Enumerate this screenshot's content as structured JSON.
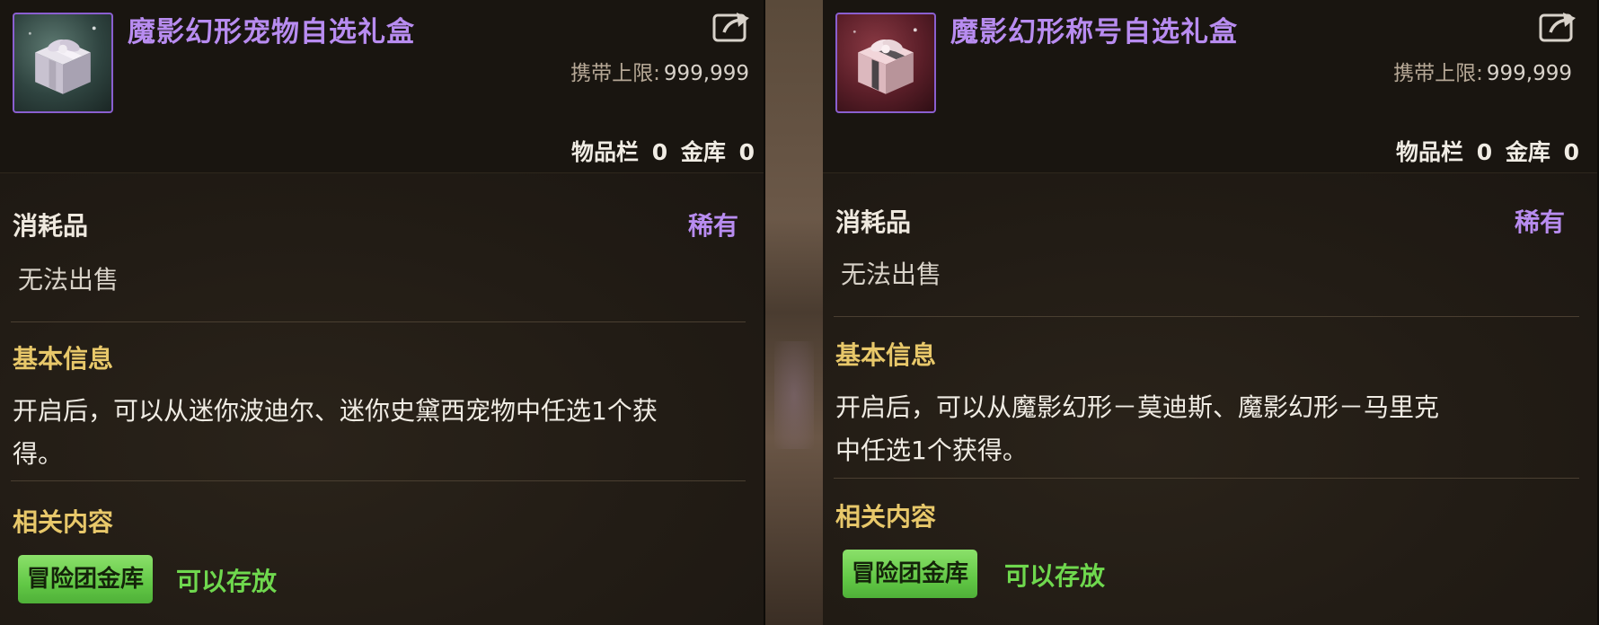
{
  "panels": [
    {
      "title": "魔影幻形宠物自选礼盒",
      "icon": "gift-box-icon",
      "icon_bg": "#2f4440",
      "carry_limit_label": "携带上限:",
      "carry_limit_value": "999,999",
      "inventory_label": "物品栏",
      "inventory_count": "0",
      "bank_label": "金库",
      "bank_count": "0",
      "category": "消耗品",
      "rarity": "稀有",
      "sell_status": "无法出售",
      "basic_info_title": "基本信息",
      "description": "开启后，可以从迷你波迪尔、迷你史黛西宠物中任选1个获得。",
      "related_title": "相关内容",
      "guild_bank_label": "冒险团金库",
      "storable_text": "可以存放"
    },
    {
      "title": "魔影幻形称号自选礼盒",
      "icon": "gift-box-icon",
      "icon_bg": "#5a1e28",
      "carry_limit_label": "携带上限:",
      "carry_limit_value": "999,999",
      "inventory_label": "物品栏",
      "inventory_count": "0",
      "bank_label": "金库",
      "bank_count": "0",
      "category": "消耗品",
      "rarity": "稀有",
      "sell_status": "无法出售",
      "basic_info_title": "基本信息",
      "description_line1": "开启后，可以从魔影幻形－莫迪斯、魔影幻形－马里克",
      "description_line2": "中任选1个获得。",
      "related_title": "相关内容",
      "guild_bank_label": "冒险团金库",
      "storable_text": "可以存放"
    }
  ],
  "colors": {
    "title_purple": "#b88cf0",
    "section_gold": "#e8c86a",
    "storable_green": "#6fd84e",
    "button_green": "#62c846"
  }
}
